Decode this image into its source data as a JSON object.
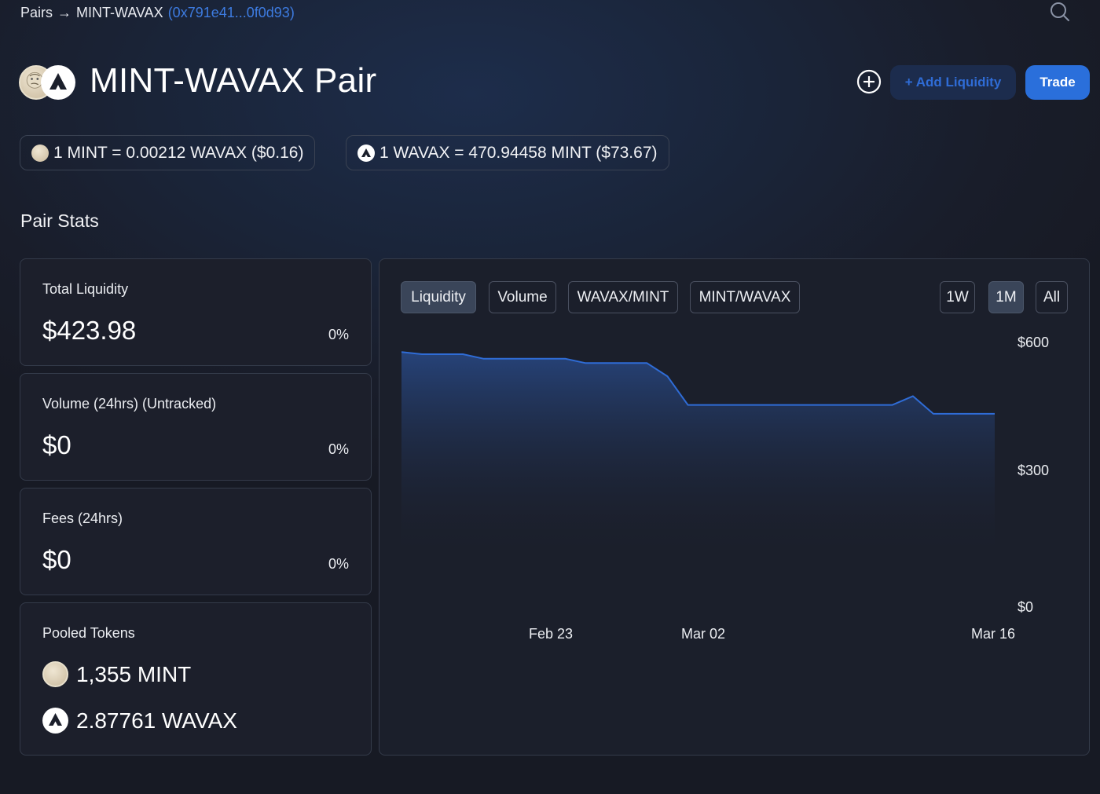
{
  "breadcrumb": {
    "root": "Pairs",
    "arrow": "→",
    "pair": "MINT-WAVAX",
    "address": "(0x791e41...0f0d93)"
  },
  "header": {
    "title": "MINT-WAVAX Pair",
    "add_liquidity": "+ Add Liquidity",
    "trade": "Trade"
  },
  "prices": {
    "mint_price": "1 MINT = 0.00212 WAVAX ($0.16)",
    "wavax_price": "1 WAVAX = 470.94458 MINT ($73.67)"
  },
  "section_title": "Pair Stats",
  "stats": [
    {
      "label": "Total Liquidity",
      "value": "$423.98",
      "change": "0%"
    },
    {
      "label": "Volume (24hrs) (Untracked)",
      "value": "$0",
      "change": "0%"
    },
    {
      "label": "Fees (24hrs)",
      "value": "$0",
      "change": "0%"
    }
  ],
  "pooled": {
    "label": "Pooled Tokens",
    "tokens": [
      {
        "amount": "1,355 MINT",
        "icon": "mint-token-icon"
      },
      {
        "amount": "2.87761 WAVAX",
        "icon": "avax-token-icon"
      }
    ]
  },
  "chart_tabs": [
    "Liquidity",
    "Volume",
    "WAVAX/MINT",
    "MINT/WAVAX"
  ],
  "range_tabs": [
    "1W",
    "1M",
    "All"
  ],
  "colors": {
    "accent": "#2a6fdb",
    "line": "#2f6cd6",
    "link": "#3d7be0"
  },
  "chart_data": {
    "type": "area",
    "title": "",
    "x_labels": [
      "Feb 23",
      "Mar 02",
      "Mar 16"
    ],
    "y_ticks": [
      "$600",
      "$300",
      "$0"
    ],
    "ylim": [
      0,
      600
    ],
    "x": [
      "Feb 15",
      "Feb 16",
      "Feb 17",
      "Feb 18",
      "Feb 19",
      "Feb 20",
      "Feb 21",
      "Feb 22",
      "Feb 23",
      "Feb 24",
      "Feb 25",
      "Feb 26",
      "Feb 27",
      "Feb 28",
      "Mar 01",
      "Mar 02",
      "Mar 03",
      "Mar 04",
      "Mar 05",
      "Mar 06",
      "Mar 07",
      "Mar 08",
      "Mar 09",
      "Mar 10",
      "Mar 11",
      "Mar 12",
      "Mar 13",
      "Mar 14",
      "Mar 15",
      "Mar 16"
    ],
    "values": [
      580,
      575,
      575,
      575,
      565,
      565,
      565,
      565,
      565,
      555,
      555,
      555,
      555,
      525,
      460,
      460,
      460,
      460,
      460,
      460,
      460,
      460,
      460,
      460,
      460,
      480,
      440,
      440,
      440,
      440
    ],
    "active_tab": "Liquidity",
    "active_range": "1M"
  }
}
